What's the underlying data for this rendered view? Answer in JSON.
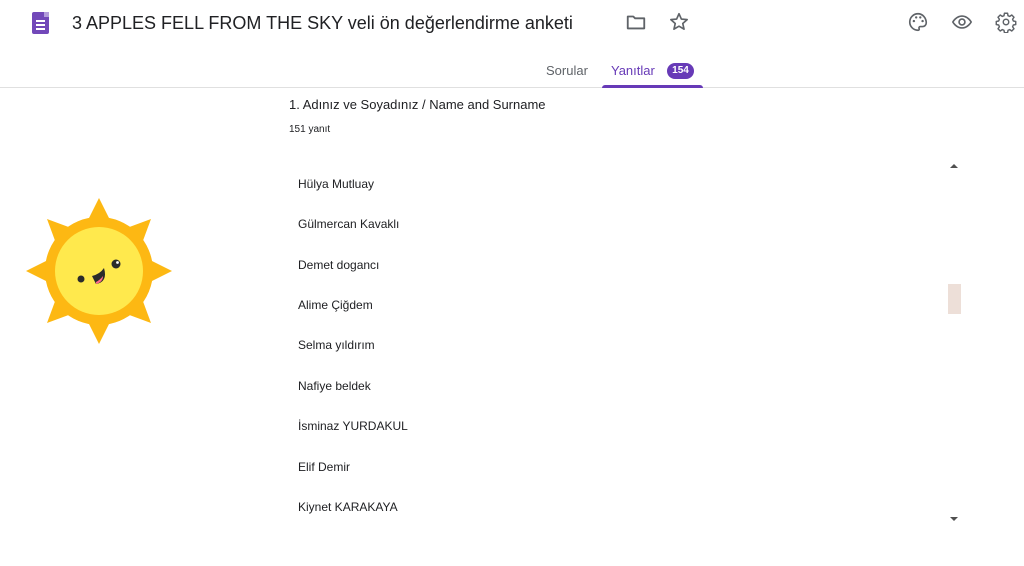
{
  "header": {
    "title": "3 APPLES FELL FROM THE SKY veli ön değerlendirme anketi",
    "icons": [
      "forms-logo-icon",
      "folder-icon",
      "star-icon",
      "palette-icon",
      "eye-icon",
      "gear-icon"
    ]
  },
  "tabs": {
    "questions_label": "Sorular",
    "responses_label": "Yanıtlar",
    "responses_count": "154"
  },
  "question": {
    "title": "1. Adınız ve Soyadınız / Name and Surname",
    "response_count": "151 yanıt"
  },
  "answers": [
    "Hülya Mutluay",
    "Gülmercan Kavaklı",
    "Demet dogancı",
    "Alime Çiğdem",
    "Selma yıldırım",
    "Nafiye beldek",
    "İsminaz YURDAKUL",
    "Elif Demir",
    "Kiynet KARAKAYA"
  ],
  "colors": {
    "accent": "#673ab7",
    "sun_outer": "#fdb813",
    "sun_inner": "#ffe94d"
  }
}
